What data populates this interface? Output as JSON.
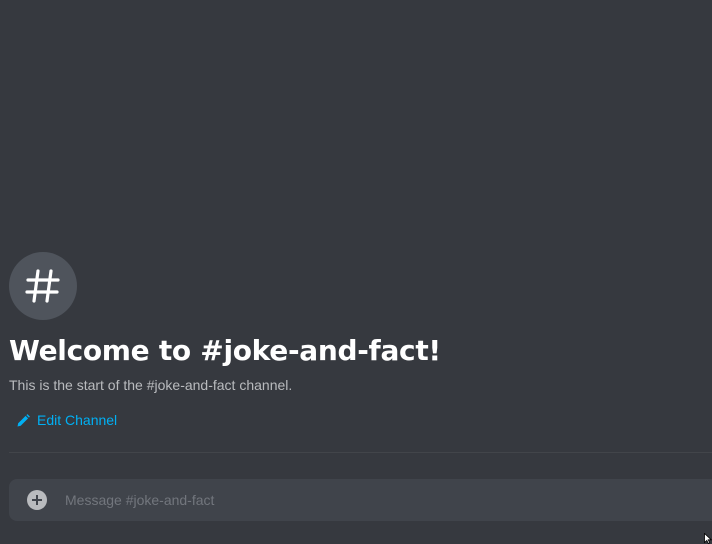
{
  "channel": {
    "icon": "hash-icon",
    "welcome_title": "Welcome to #joke-and-fact!",
    "welcome_subtitle": "This is the start of the #joke-and-fact channel.",
    "edit_label": "Edit Channel"
  },
  "composer": {
    "attach_icon": "plus-circle-icon",
    "placeholder": "Message #joke-and-fact"
  },
  "colors": {
    "background": "#36393f",
    "accent_link": "#00b0f4",
    "title": "#ffffff",
    "subtitle": "#b9bbbe",
    "composer_bg": "#40444b"
  }
}
